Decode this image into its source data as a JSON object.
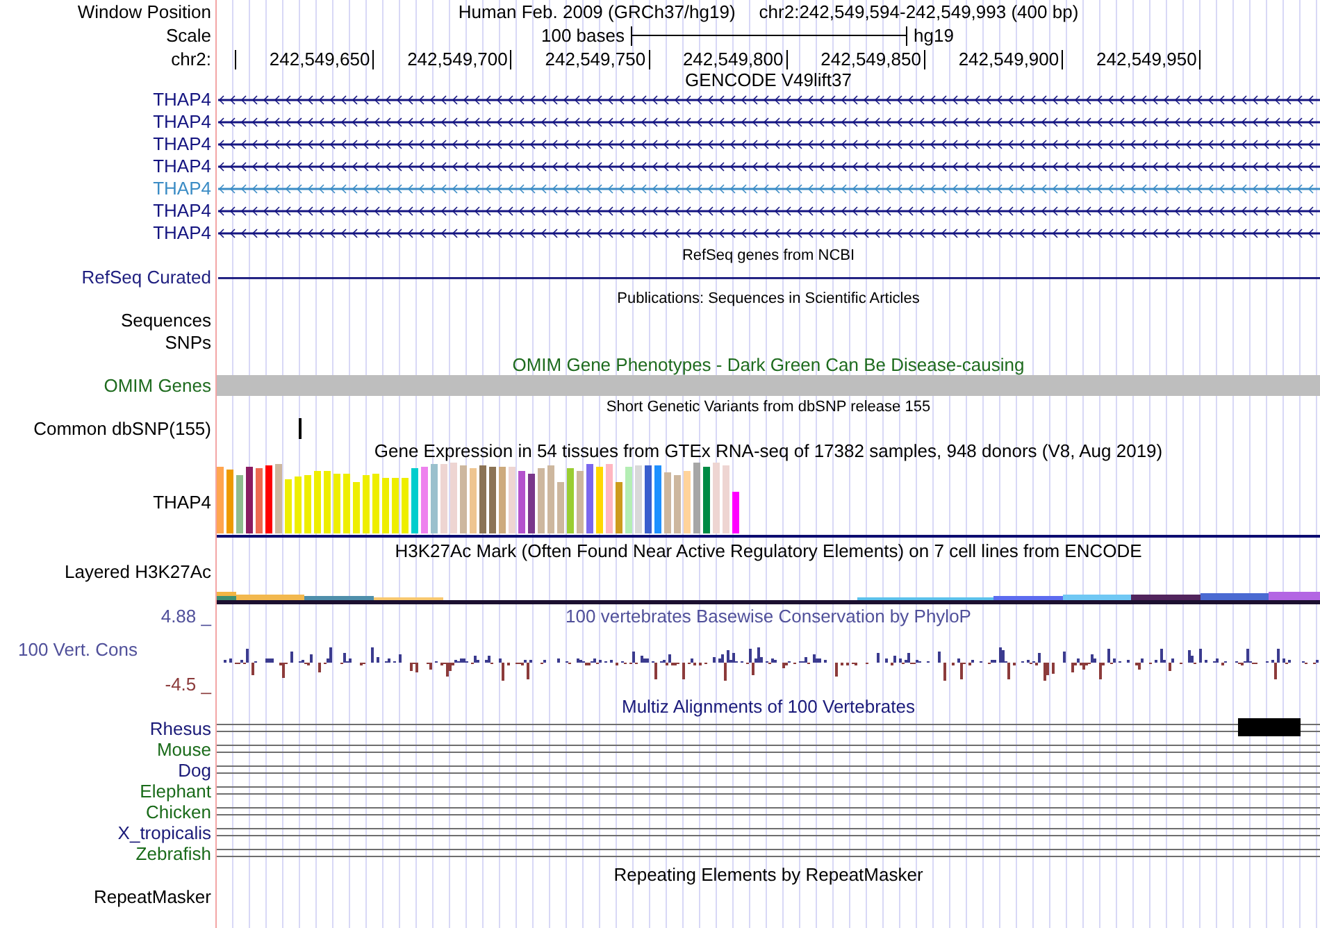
{
  "header": {
    "position_row": {
      "label": "Window Position",
      "assembly": "Human Feb. 2009 (GRCh37/hg19)",
      "range": "chr2:242,549,594-242,549,993 (400 bp)"
    },
    "scale_row": {
      "label": "Scale",
      "bar_text": "100 bases",
      "database": "hg19"
    },
    "ruler_row": {
      "label": "chr2:",
      "ticks": [
        "242,549,650",
        "242,549,700",
        "242,549,750",
        "242,549,800",
        "242,549,850",
        "242,549,900",
        "242,549,950"
      ]
    }
  },
  "tracks": [
    {
      "kind": "genes",
      "title": "GENCODE V49lift37",
      "transcripts": [
        {
          "label": "THAP4",
          "color": "#141480"
        },
        {
          "label": "THAP4",
          "color": "#141480"
        },
        {
          "label": "THAP4",
          "color": "#141480"
        },
        {
          "label": "THAP4",
          "color": "#141480"
        },
        {
          "label": "THAP4",
          "color": "#3b8cc5"
        },
        {
          "label": "THAP4",
          "color": "#141480"
        },
        {
          "label": "THAP4",
          "color": "#141480"
        }
      ]
    },
    {
      "kind": "refseq",
      "title": "RefSeq genes from NCBI",
      "label": "RefSeq Curated"
    },
    {
      "kind": "publications",
      "title": "Publications: Sequences in Scientific Articles",
      "labels": [
        "Sequences",
        "SNPs"
      ]
    },
    {
      "kind": "omim",
      "title": "OMIM Gene Phenotypes - Dark Green Can Be Disease-causing",
      "label": "OMIM Genes"
    },
    {
      "kind": "snp",
      "title": "Short Genetic Variants from dbSNP release 155",
      "label": "Common dbSNP(155)"
    },
    {
      "kind": "expression",
      "title": "Gene Expression in 54 tissues from GTEx RNA-seq of 17382 samples, 948 donors (V8, Aug 2019)",
      "label": "THAP4",
      "bars": [
        {
          "color": "#ffa54f"
        },
        {
          "color": "#ee9a00"
        },
        {
          "color": "#8fbc8f"
        },
        {
          "color": "#8b1c62"
        },
        {
          "color": "#ee6a50"
        },
        {
          "color": "#ff0000"
        },
        {
          "color": "#cdb79e"
        },
        {
          "color": "#eeee00"
        },
        {
          "color": "#eeee00"
        },
        {
          "color": "#eeee00"
        },
        {
          "color": "#eeee00"
        },
        {
          "color": "#eeee00"
        },
        {
          "color": "#eeee00"
        },
        {
          "color": "#eeee00"
        },
        {
          "color": "#eeee00"
        },
        {
          "color": "#eeee00"
        },
        {
          "color": "#eeee00"
        },
        {
          "color": "#eeee00"
        },
        {
          "color": "#eeee00"
        },
        {
          "color": "#eeee00"
        },
        {
          "color": "#00cdcd"
        },
        {
          "color": "#ee82ee"
        },
        {
          "color": "#9ac0cd"
        },
        {
          "color": "#eed5d2"
        },
        {
          "color": "#eed5d2"
        },
        {
          "color": "#cdb79e"
        },
        {
          "color": "#eec591"
        },
        {
          "color": "#8b7355"
        },
        {
          "color": "#8b7355"
        },
        {
          "color": "#cdaa7d"
        },
        {
          "color": "#eed5d2"
        },
        {
          "color": "#b452cd"
        },
        {
          "color": "#7a378b"
        },
        {
          "color": "#cdb79e"
        },
        {
          "color": "#cdb79e"
        },
        {
          "color": "#cdb79e"
        },
        {
          "color": "#9acd32"
        },
        {
          "color": "#cdb79e"
        },
        {
          "color": "#7a67ee"
        },
        {
          "color": "#ffd700"
        },
        {
          "color": "#ffb6c1"
        },
        {
          "color": "#cd9b1d"
        },
        {
          "color": "#b4eeb4"
        },
        {
          "color": "#d9d9d9"
        },
        {
          "color": "#3a5fcd"
        },
        {
          "color": "#1e90ff"
        },
        {
          "color": "#cdb79e"
        },
        {
          "color": "#cdb79e"
        },
        {
          "color": "#ffd39b"
        },
        {
          "color": "#a6a6a6"
        },
        {
          "color": "#008b45"
        },
        {
          "color": "#eed5d2"
        },
        {
          "color": "#eed5d2"
        },
        {
          "color": "#ff00ff"
        }
      ]
    },
    {
      "kind": "layered",
      "title": "H3K27Ac Mark (Often Found Near Active Regulatory Elements) on 7 cell lines from ENCODE",
      "label": "Layered H3K27Ac"
    },
    {
      "kind": "wiggle",
      "title": "100 vertebrates Basewise Conservation by PhyloP",
      "label": "100 Vert. Cons",
      "max_label": "4.88 _",
      "min_label": "-4.5 _"
    },
    {
      "kind": "alignment",
      "title": "Multiz Alignments of 100 Vertebrates",
      "species": [
        {
          "label": "Rhesus",
          "color": "#1a1a78"
        },
        {
          "label": "Mouse",
          "color": "#1a6b1a"
        },
        {
          "label": "Dog",
          "color": "#1a1a78"
        },
        {
          "label": "Elephant",
          "color": "#1a6b1a"
        },
        {
          "label": "Chicken",
          "color": "#1a6b1a"
        },
        {
          "label": "X_tropicalis",
          "color": "#1a1a78"
        },
        {
          "label": "Zebrafish",
          "color": "#1a6b1a"
        }
      ]
    },
    {
      "kind": "repeats",
      "title": "Repeating Elements by RepeatMasker",
      "label": "RepeatMasker"
    }
  ]
}
